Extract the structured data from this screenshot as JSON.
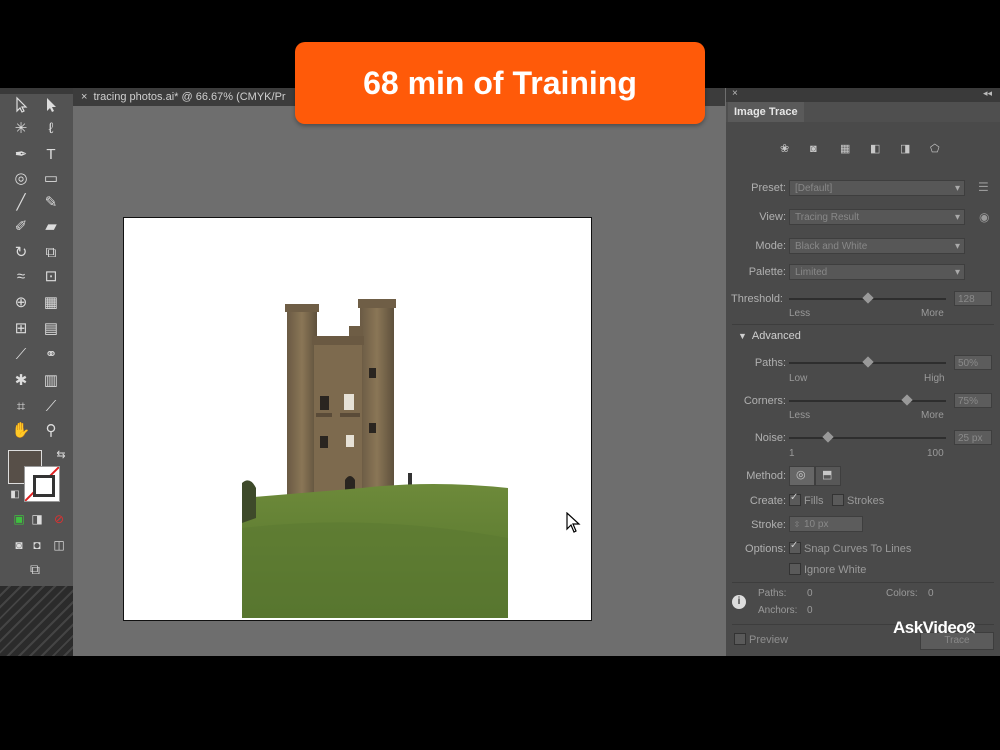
{
  "banner": {
    "text": "68 min of Training"
  },
  "document": {
    "tab_title": "tracing photos.ai* @ 66.67% (CMYK/Pr"
  },
  "panel": {
    "title": "Image Trace",
    "preset": {
      "label": "Preset:",
      "value": "[Default]"
    },
    "view": {
      "label": "View:",
      "value": "Tracing Result"
    },
    "mode": {
      "label": "Mode:",
      "value": "Black and White"
    },
    "palette": {
      "label": "Palette:",
      "value": "Limited"
    },
    "threshold": {
      "label": "Threshold:",
      "value": "128",
      "level": 0.5,
      "min_label": "Less",
      "max_label": "More"
    },
    "advanced": {
      "label": "Advanced"
    },
    "paths": {
      "label": "Paths:",
      "value": "50%",
      "level": 0.5,
      "min_label": "Low",
      "max_label": "High"
    },
    "corners": {
      "label": "Corners:",
      "value": "75%",
      "level": 0.75,
      "min_label": "Less",
      "max_label": "More"
    },
    "noise": {
      "label": "Noise:",
      "value": "25 px",
      "level": 0.25,
      "min_label": "1",
      "max_label": "100"
    },
    "method": {
      "label": "Method:"
    },
    "create": {
      "label": "Create:",
      "fills": "Fills",
      "strokes": "Strokes"
    },
    "stroke": {
      "label": "Stroke:",
      "value": "10 px"
    },
    "options": {
      "label": "Options:",
      "snap": "Snap Curves To Lines",
      "ignore_white": "Ignore White"
    },
    "info": {
      "paths_label": "Paths:",
      "paths_value": "0",
      "colors_label": "Colors:",
      "colors_value": "0",
      "anchors_label": "Anchors:",
      "anchors_value": "0"
    },
    "preview": {
      "label": "Preview"
    },
    "trace_button": {
      "label": "Trace"
    }
  },
  "brand": {
    "text": "AskVideo"
  },
  "colors": {
    "banner": "#ff5a09",
    "fill_swatch": "#574f48"
  }
}
